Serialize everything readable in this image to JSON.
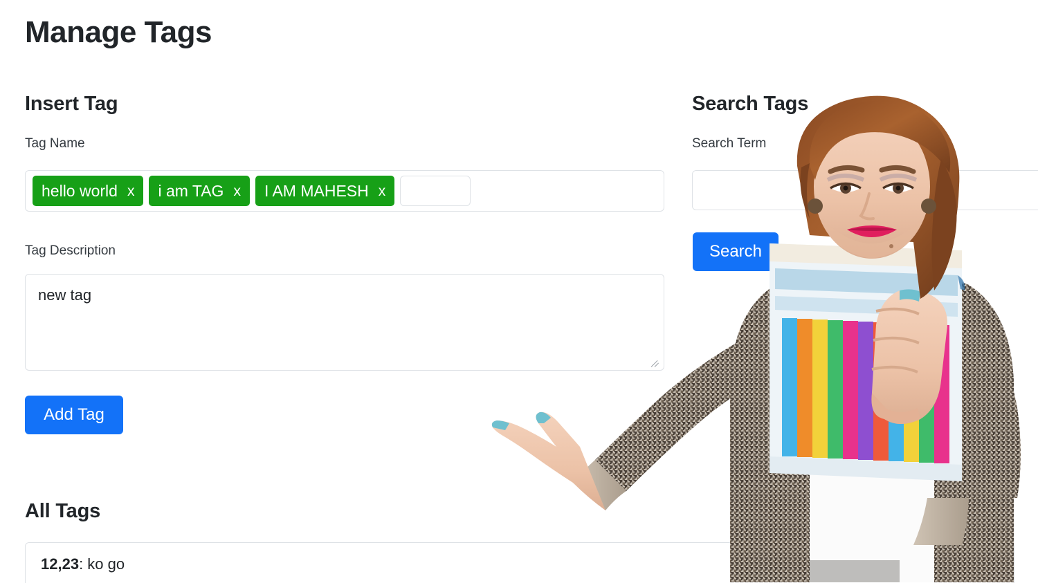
{
  "page_title": "Manage Tags",
  "insert_section": {
    "heading": "Insert Tag",
    "tag_name_label": "Tag Name",
    "tags": [
      {
        "text": "hello world",
        "remove": "x"
      },
      {
        "text": "i am TAG",
        "remove": "x"
      },
      {
        "text": "I AM MAHESH",
        "remove": "x"
      }
    ],
    "tag_entry_value": "",
    "tag_entry_placeholder": "",
    "tag_desc_label": "Tag Description",
    "tag_desc_value": "new tag",
    "tag_desc_placeholder": "",
    "add_button_label": "Add Tag"
  },
  "search_section": {
    "heading": "Search Tags",
    "search_term_label": "Search Term",
    "search_value": "",
    "search_placeholder": "",
    "search_button_label": "Search"
  },
  "all_tags_section": {
    "heading": "All Tags",
    "items": [
      {
        "id": "12,23",
        "separator": ": ",
        "description": "ko go"
      }
    ]
  },
  "colors": {
    "tag_green": "#17a017",
    "primary_blue": "#1372f8",
    "border_gray": "#dee2e6",
    "text_dark": "#212529"
  },
  "photo": {
    "alt": "smiling woman in houndstooth blazer holding colorful folders presenting with open hand"
  }
}
